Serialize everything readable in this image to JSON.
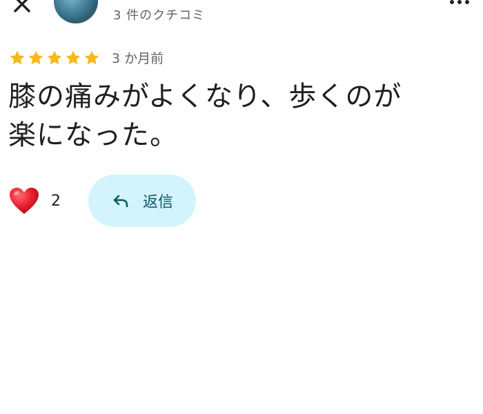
{
  "header": {
    "close_icon": "close-icon",
    "avatar": "avatar",
    "review_count": "3 件のクチコミ",
    "more_icon": "more-horiz-icon"
  },
  "review": {
    "rating": 5,
    "max_rating": 5,
    "star_color": "#f6b81a",
    "date": "3 か月前",
    "text_line1": "膝の痛みがよくなり、歩くのが",
    "text_line2": "楽になった。"
  },
  "actions": {
    "like_icon": "heart-icon",
    "like_count": "2",
    "reply_icon": "reply-icon",
    "reply_label": "返信",
    "reply_bg": "#d3f4fc"
  }
}
